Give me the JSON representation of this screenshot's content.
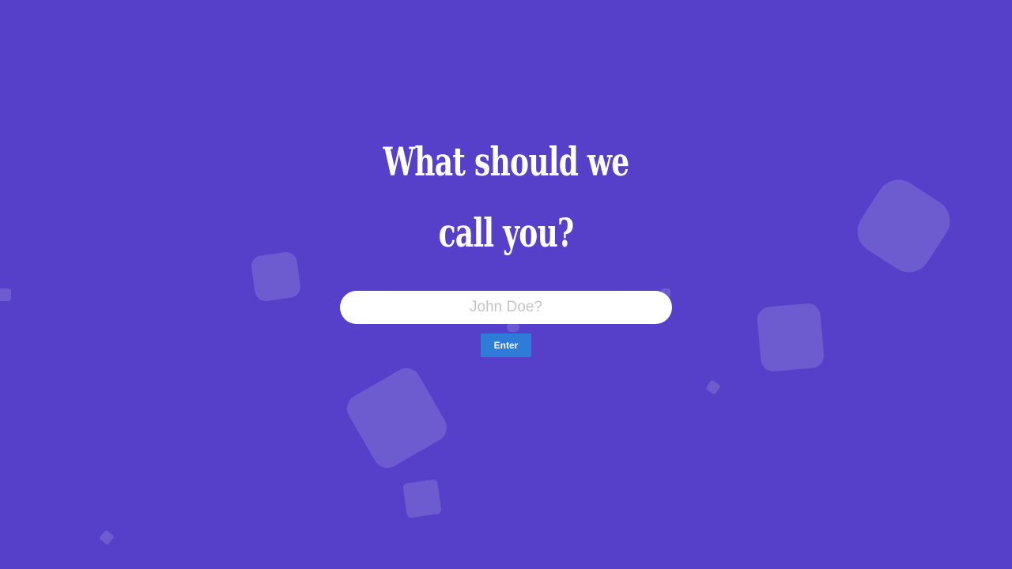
{
  "colors": {
    "background": "#5640c9",
    "title": "#ffffff",
    "input_background": "#ffffff",
    "placeholder": "#c4c4c4",
    "button": "#2f7bd8",
    "button_text": "#ffffff"
  },
  "prompt": {
    "title": "What should we call you?"
  },
  "name_input": {
    "value": "",
    "placeholder": "John Doe?"
  },
  "enter_button": {
    "label": "Enter"
  }
}
